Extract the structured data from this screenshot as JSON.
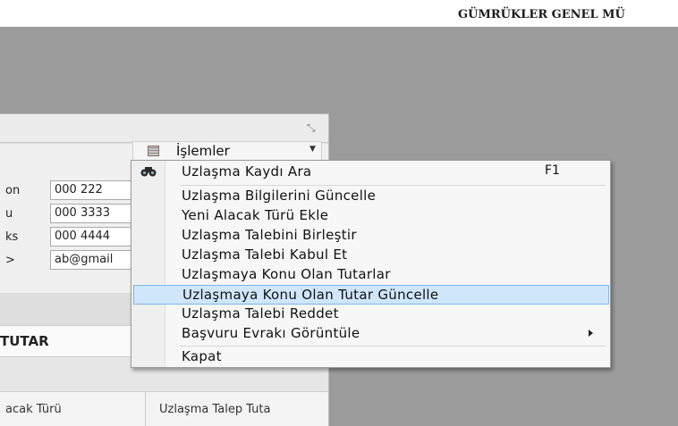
{
  "header": {
    "title": "GÜMRÜKLER GENEL MÜ"
  },
  "panel": {
    "fields": [
      {
        "label": "on",
        "value": "000 222"
      },
      {
        "label": "u",
        "value": "000 3333"
      },
      {
        "label": "ks",
        "value": "000 4444"
      },
      {
        "label": ">",
        "value": "ab@gmail"
      }
    ],
    "section_title": "TUTAR",
    "grid": {
      "columns": [
        "acak Türü",
        "Uzlaşma Talep Tuta"
      ]
    }
  },
  "menu": {
    "button_label": "İşlemler",
    "items": [
      {
        "label": "Uzlaşma Kaydı Ara",
        "shortcut": "F1",
        "icon": "binoculars-icon"
      },
      {
        "label": "Uzlaşma Bilgilerini Güncelle"
      },
      {
        "label": "Yeni Alacak Türü Ekle"
      },
      {
        "label": "Uzlaşma Talebini Birleştir"
      },
      {
        "label": "Uzlaşma Talebi Kabul Et"
      },
      {
        "label": "Uzlaşmaya Konu Olan Tutarlar"
      },
      {
        "label": "Uzlaşmaya Konu Olan Tutar Güncelle",
        "state": "highlighted"
      },
      {
        "label": "Uzlaşma Talebi Reddet"
      },
      {
        "label": "Başvuru Evrakı Görüntüle",
        "submenu": true
      },
      {
        "label": "Kapat"
      }
    ]
  },
  "colors": {
    "highlight": "#cfe6fb",
    "highlight_border": "#7eb4ea",
    "backdrop": "#9b9b9b"
  }
}
